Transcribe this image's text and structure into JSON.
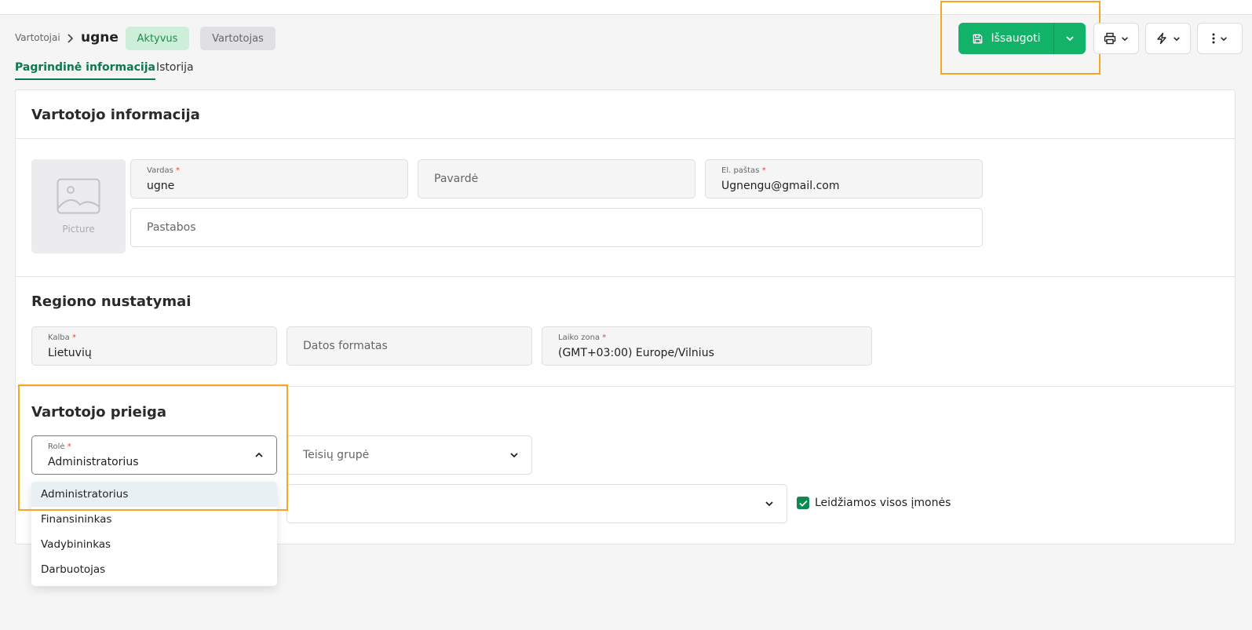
{
  "breadcrumb": {
    "parent": "Vartotojai",
    "current": "ugne"
  },
  "badges": {
    "status": "Aktyvus",
    "type": "Vartotojas"
  },
  "tabs": [
    {
      "label": "Pagrindinė informacija",
      "active": true
    },
    {
      "label": "Istorija",
      "active": false
    }
  ],
  "toolbar": {
    "save_label": "Išsaugoti",
    "accent": "#12b369",
    "icons": [
      "save-icon",
      "chevron-down-icon",
      "printer-icon",
      "bolt-icon",
      "more-vertical-icon"
    ]
  },
  "sections": {
    "user_info": {
      "title": "Vartotojo informacija",
      "picture_label": "Picture",
      "first_name": {
        "label": "Vardas",
        "value": "ugne",
        "required": "*"
      },
      "last_name": {
        "placeholder": "Pavardė"
      },
      "email": {
        "label": "El. paštas",
        "value": "Ugnengu@gmail.com",
        "required": "*"
      },
      "notes": {
        "placeholder": "Pastabos"
      }
    },
    "region": {
      "title": "Regiono nustatymai",
      "language": {
        "label": "Kalba",
        "value": "Lietuvių",
        "required": "*"
      },
      "date_format": {
        "placeholder": "Datos formatas"
      },
      "timezone": {
        "label": "Laiko zona",
        "value": "(GMT+03:00) Europe/Vilnius",
        "required": "*"
      }
    },
    "access": {
      "title": "Vartotojo prieiga",
      "role": {
        "label": "Rolė",
        "value": "Administratorius",
        "required": "*",
        "open": true
      },
      "rights_group": {
        "placeholder": "Teisių grupė"
      },
      "all_companies_label": "Leidžiamos visos įmonės",
      "all_companies_checked": true
    }
  },
  "role_options": [
    "Administratorius",
    "Finansininkas",
    "Vadybininkas",
    "Darbuotojas"
  ]
}
